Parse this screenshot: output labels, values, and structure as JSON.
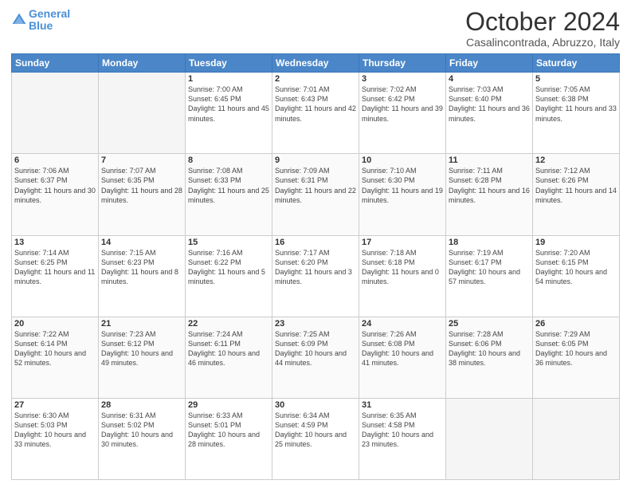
{
  "header": {
    "logo_line1": "General",
    "logo_line2": "Blue",
    "title": "October 2024",
    "subtitle": "Casalincontrada, Abruzzo, Italy"
  },
  "calendar": {
    "days_of_week": [
      "Sunday",
      "Monday",
      "Tuesday",
      "Wednesday",
      "Thursday",
      "Friday",
      "Saturday"
    ],
    "weeks": [
      [
        {
          "day": "",
          "empty": true
        },
        {
          "day": "",
          "empty": true
        },
        {
          "day": "1",
          "sunrise": "7:00 AM",
          "sunset": "6:45 PM",
          "daylight": "11 hours and 45 minutes."
        },
        {
          "day": "2",
          "sunrise": "7:01 AM",
          "sunset": "6:43 PM",
          "daylight": "11 hours and 42 minutes."
        },
        {
          "day": "3",
          "sunrise": "7:02 AM",
          "sunset": "6:42 PM",
          "daylight": "11 hours and 39 minutes."
        },
        {
          "day": "4",
          "sunrise": "7:03 AM",
          "sunset": "6:40 PM",
          "daylight": "11 hours and 36 minutes."
        },
        {
          "day": "5",
          "sunrise": "7:05 AM",
          "sunset": "6:38 PM",
          "daylight": "11 hours and 33 minutes."
        }
      ],
      [
        {
          "day": "6",
          "sunrise": "7:06 AM",
          "sunset": "6:37 PM",
          "daylight": "11 hours and 30 minutes."
        },
        {
          "day": "7",
          "sunrise": "7:07 AM",
          "sunset": "6:35 PM",
          "daylight": "11 hours and 28 minutes."
        },
        {
          "day": "8",
          "sunrise": "7:08 AM",
          "sunset": "6:33 PM",
          "daylight": "11 hours and 25 minutes."
        },
        {
          "day": "9",
          "sunrise": "7:09 AM",
          "sunset": "6:31 PM",
          "daylight": "11 hours and 22 minutes."
        },
        {
          "day": "10",
          "sunrise": "7:10 AM",
          "sunset": "6:30 PM",
          "daylight": "11 hours and 19 minutes."
        },
        {
          "day": "11",
          "sunrise": "7:11 AM",
          "sunset": "6:28 PM",
          "daylight": "11 hours and 16 minutes."
        },
        {
          "day": "12",
          "sunrise": "7:12 AM",
          "sunset": "6:26 PM",
          "daylight": "11 hours and 14 minutes."
        }
      ],
      [
        {
          "day": "13",
          "sunrise": "7:14 AM",
          "sunset": "6:25 PM",
          "daylight": "11 hours and 11 minutes."
        },
        {
          "day": "14",
          "sunrise": "7:15 AM",
          "sunset": "6:23 PM",
          "daylight": "11 hours and 8 minutes."
        },
        {
          "day": "15",
          "sunrise": "7:16 AM",
          "sunset": "6:22 PM",
          "daylight": "11 hours and 5 minutes."
        },
        {
          "day": "16",
          "sunrise": "7:17 AM",
          "sunset": "6:20 PM",
          "daylight": "11 hours and 3 minutes."
        },
        {
          "day": "17",
          "sunrise": "7:18 AM",
          "sunset": "6:18 PM",
          "daylight": "11 hours and 0 minutes."
        },
        {
          "day": "18",
          "sunrise": "7:19 AM",
          "sunset": "6:17 PM",
          "daylight": "10 hours and 57 minutes."
        },
        {
          "day": "19",
          "sunrise": "7:20 AM",
          "sunset": "6:15 PM",
          "daylight": "10 hours and 54 minutes."
        }
      ],
      [
        {
          "day": "20",
          "sunrise": "7:22 AM",
          "sunset": "6:14 PM",
          "daylight": "10 hours and 52 minutes."
        },
        {
          "day": "21",
          "sunrise": "7:23 AM",
          "sunset": "6:12 PM",
          "daylight": "10 hours and 49 minutes."
        },
        {
          "day": "22",
          "sunrise": "7:24 AM",
          "sunset": "6:11 PM",
          "daylight": "10 hours and 46 minutes."
        },
        {
          "day": "23",
          "sunrise": "7:25 AM",
          "sunset": "6:09 PM",
          "daylight": "10 hours and 44 minutes."
        },
        {
          "day": "24",
          "sunrise": "7:26 AM",
          "sunset": "6:08 PM",
          "daylight": "10 hours and 41 minutes."
        },
        {
          "day": "25",
          "sunrise": "7:28 AM",
          "sunset": "6:06 PM",
          "daylight": "10 hours and 38 minutes."
        },
        {
          "day": "26",
          "sunrise": "7:29 AM",
          "sunset": "6:05 PM",
          "daylight": "10 hours and 36 minutes."
        }
      ],
      [
        {
          "day": "27",
          "sunrise": "6:30 AM",
          "sunset": "5:03 PM",
          "daylight": "10 hours and 33 minutes."
        },
        {
          "day": "28",
          "sunrise": "6:31 AM",
          "sunset": "5:02 PM",
          "daylight": "10 hours and 30 minutes."
        },
        {
          "day": "29",
          "sunrise": "6:33 AM",
          "sunset": "5:01 PM",
          "daylight": "10 hours and 28 minutes."
        },
        {
          "day": "30",
          "sunrise": "6:34 AM",
          "sunset": "4:59 PM",
          "daylight": "10 hours and 25 minutes."
        },
        {
          "day": "31",
          "sunrise": "6:35 AM",
          "sunset": "4:58 PM",
          "daylight": "10 hours and 23 minutes."
        },
        {
          "day": "",
          "empty": true
        },
        {
          "day": "",
          "empty": true
        }
      ]
    ]
  }
}
